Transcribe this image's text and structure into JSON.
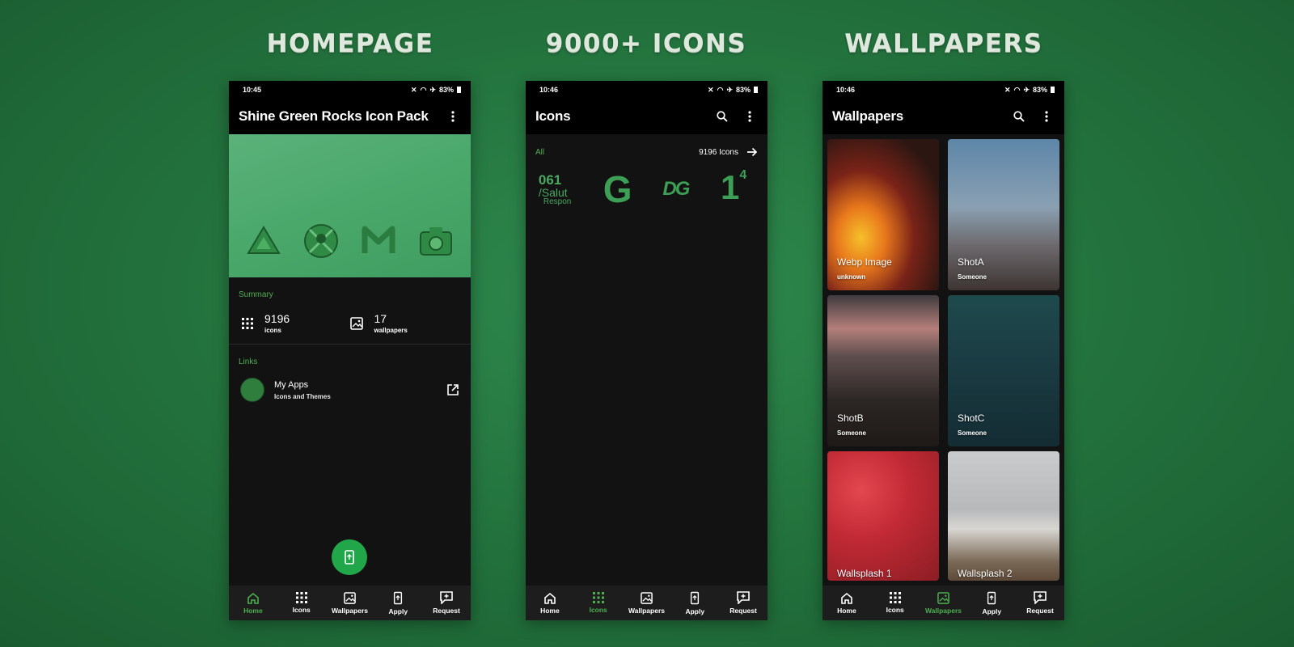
{
  "banners": {
    "homepage": "HOMEPAGE",
    "icons": "9000+ ICONS",
    "wallpapers": "WALLPAPERS"
  },
  "colors": {
    "accent": "#4caf50",
    "fab": "#22a64a",
    "background": "#121212"
  },
  "nav": {
    "home": "Home",
    "icons": "Icons",
    "wallpapers": "Wallpapers",
    "apply": "Apply",
    "request": "Request"
  },
  "status": {
    "battery": "83%"
  },
  "home": {
    "time": "10:45",
    "title": "Shine Green Rocks Icon Pack",
    "summary_label": "Summary",
    "icons_count": "9196",
    "icons_sub": "icons",
    "wallpapers_count": "17",
    "wallpapers_sub": "wallpapers",
    "links_label": "Links",
    "link_title": "My Apps",
    "link_sub": "Icons and Themes"
  },
  "icons_page": {
    "time": "10:46",
    "title": "Icons",
    "filter": "All",
    "count": "9196 Icons",
    "icon_1_line1": "061",
    "icon_1_line2": "/Salut",
    "icon_1_line3": "Respon",
    "icon_2": "G",
    "icon_3": "DG",
    "icon_4": "1",
    "icon_4_sup": "4"
  },
  "wall_page": {
    "time": "10:46",
    "title": "Wallpapers",
    "items": [
      {
        "title": "Webp Image",
        "author": "unknown"
      },
      {
        "title": "ShotA",
        "author": "Someone"
      },
      {
        "title": "ShotB",
        "author": "Someone"
      },
      {
        "title": "ShotC",
        "author": "Someone"
      },
      {
        "title": "Wallsplash 1",
        "author": ""
      },
      {
        "title": "Wallsplash 2",
        "author": ""
      }
    ]
  }
}
